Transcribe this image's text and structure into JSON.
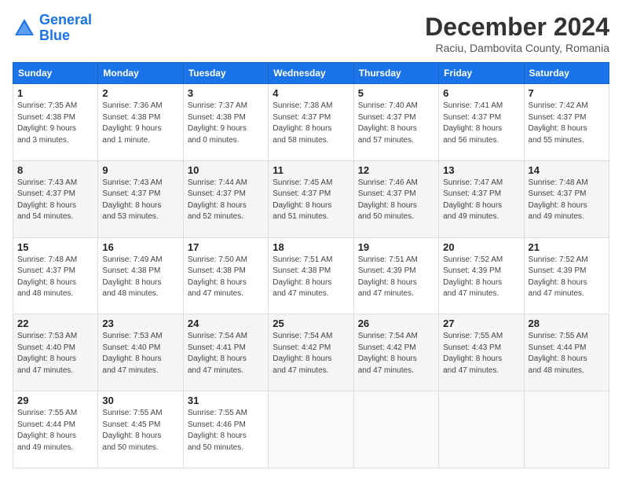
{
  "header": {
    "logo_line1": "General",
    "logo_line2": "Blue",
    "title": "December 2024",
    "subtitle": "Raciu, Dambovita County, Romania"
  },
  "calendar": {
    "days_of_week": [
      "Sunday",
      "Monday",
      "Tuesday",
      "Wednesday",
      "Thursday",
      "Friday",
      "Saturday"
    ],
    "weeks": [
      [
        {
          "day": "1",
          "info": "Sunrise: 7:35 AM\nSunset: 4:38 PM\nDaylight: 9 hours\nand 3 minutes."
        },
        {
          "day": "2",
          "info": "Sunrise: 7:36 AM\nSunset: 4:38 PM\nDaylight: 9 hours\nand 1 minute."
        },
        {
          "day": "3",
          "info": "Sunrise: 7:37 AM\nSunset: 4:38 PM\nDaylight: 9 hours\nand 0 minutes."
        },
        {
          "day": "4",
          "info": "Sunrise: 7:38 AM\nSunset: 4:37 PM\nDaylight: 8 hours\nand 58 minutes."
        },
        {
          "day": "5",
          "info": "Sunrise: 7:40 AM\nSunset: 4:37 PM\nDaylight: 8 hours\nand 57 minutes."
        },
        {
          "day": "6",
          "info": "Sunrise: 7:41 AM\nSunset: 4:37 PM\nDaylight: 8 hours\nand 56 minutes."
        },
        {
          "day": "7",
          "info": "Sunrise: 7:42 AM\nSunset: 4:37 PM\nDaylight: 8 hours\nand 55 minutes."
        }
      ],
      [
        {
          "day": "8",
          "info": "Sunrise: 7:43 AM\nSunset: 4:37 PM\nDaylight: 8 hours\nand 54 minutes."
        },
        {
          "day": "9",
          "info": "Sunrise: 7:43 AM\nSunset: 4:37 PM\nDaylight: 8 hours\nand 53 minutes."
        },
        {
          "day": "10",
          "info": "Sunrise: 7:44 AM\nSunset: 4:37 PM\nDaylight: 8 hours\nand 52 minutes."
        },
        {
          "day": "11",
          "info": "Sunrise: 7:45 AM\nSunset: 4:37 PM\nDaylight: 8 hours\nand 51 minutes."
        },
        {
          "day": "12",
          "info": "Sunrise: 7:46 AM\nSunset: 4:37 PM\nDaylight: 8 hours\nand 50 minutes."
        },
        {
          "day": "13",
          "info": "Sunrise: 7:47 AM\nSunset: 4:37 PM\nDaylight: 8 hours\nand 49 minutes."
        },
        {
          "day": "14",
          "info": "Sunrise: 7:48 AM\nSunset: 4:37 PM\nDaylight: 8 hours\nand 49 minutes."
        }
      ],
      [
        {
          "day": "15",
          "info": "Sunrise: 7:48 AM\nSunset: 4:37 PM\nDaylight: 8 hours\nand 48 minutes."
        },
        {
          "day": "16",
          "info": "Sunrise: 7:49 AM\nSunset: 4:38 PM\nDaylight: 8 hours\nand 48 minutes."
        },
        {
          "day": "17",
          "info": "Sunrise: 7:50 AM\nSunset: 4:38 PM\nDaylight: 8 hours\nand 47 minutes."
        },
        {
          "day": "18",
          "info": "Sunrise: 7:51 AM\nSunset: 4:38 PM\nDaylight: 8 hours\nand 47 minutes."
        },
        {
          "day": "19",
          "info": "Sunrise: 7:51 AM\nSunset: 4:39 PM\nDaylight: 8 hours\nand 47 minutes."
        },
        {
          "day": "20",
          "info": "Sunrise: 7:52 AM\nSunset: 4:39 PM\nDaylight: 8 hours\nand 47 minutes."
        },
        {
          "day": "21",
          "info": "Sunrise: 7:52 AM\nSunset: 4:39 PM\nDaylight: 8 hours\nand 47 minutes."
        }
      ],
      [
        {
          "day": "22",
          "info": "Sunrise: 7:53 AM\nSunset: 4:40 PM\nDaylight: 8 hours\nand 47 minutes."
        },
        {
          "day": "23",
          "info": "Sunrise: 7:53 AM\nSunset: 4:40 PM\nDaylight: 8 hours\nand 47 minutes."
        },
        {
          "day": "24",
          "info": "Sunrise: 7:54 AM\nSunset: 4:41 PM\nDaylight: 8 hours\nand 47 minutes."
        },
        {
          "day": "25",
          "info": "Sunrise: 7:54 AM\nSunset: 4:42 PM\nDaylight: 8 hours\nand 47 minutes."
        },
        {
          "day": "26",
          "info": "Sunrise: 7:54 AM\nSunset: 4:42 PM\nDaylight: 8 hours\nand 47 minutes."
        },
        {
          "day": "27",
          "info": "Sunrise: 7:55 AM\nSunset: 4:43 PM\nDaylight: 8 hours\nand 47 minutes."
        },
        {
          "day": "28",
          "info": "Sunrise: 7:55 AM\nSunset: 4:44 PM\nDaylight: 8 hours\nand 48 minutes."
        }
      ],
      [
        {
          "day": "29",
          "info": "Sunrise: 7:55 AM\nSunset: 4:44 PM\nDaylight: 8 hours\nand 49 minutes."
        },
        {
          "day": "30",
          "info": "Sunrise: 7:55 AM\nSunset: 4:45 PM\nDaylight: 8 hours\nand 50 minutes."
        },
        {
          "day": "31",
          "info": "Sunrise: 7:55 AM\nSunset: 4:46 PM\nDaylight: 8 hours\nand 50 minutes."
        },
        {
          "day": "",
          "info": ""
        },
        {
          "day": "",
          "info": ""
        },
        {
          "day": "",
          "info": ""
        },
        {
          "day": "",
          "info": ""
        }
      ]
    ]
  }
}
